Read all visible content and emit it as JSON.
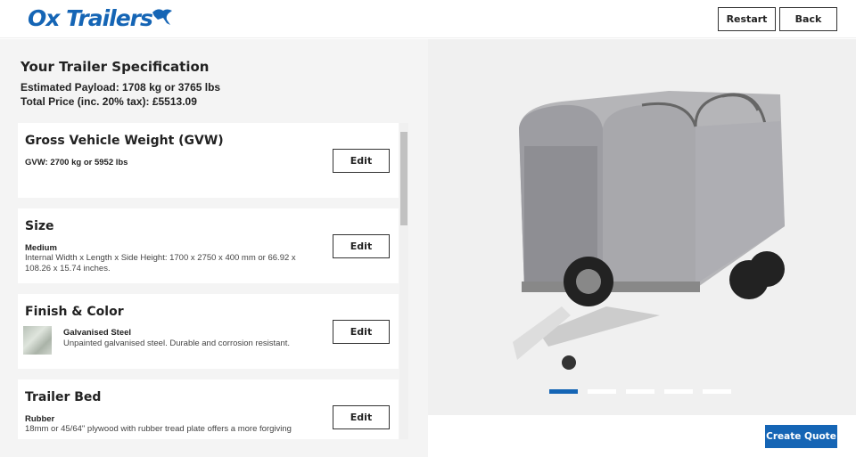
{
  "header": {
    "logo": "Ox Trailers",
    "restart": "Restart",
    "back": "Back"
  },
  "spec": {
    "title": "Your Trailer Specification",
    "payload": "Estimated Payload: 1708 kg or 3765 lbs",
    "price": "Total Price (inc. 20% tax): £5513.09"
  },
  "cards": [
    {
      "title": "Gross Vehicle Weight (GVW)",
      "bold": "GVW: 2700 kg or 5952 lbs",
      "desc": "",
      "edit": "Edit"
    },
    {
      "title": "Size",
      "bold": "Medium",
      "desc": "Internal Width x Length x Side Height: 1700 x 2750 x 400 mm or 66.92 x 108.26 x 15.74 inches.",
      "edit": "Edit"
    },
    {
      "title": "Finish & Color",
      "bold": "Galvanised Steel",
      "desc": "Unpainted galvanised steel. Durable and corrosion resistant.",
      "edit": "Edit"
    },
    {
      "title": "Trailer Bed",
      "bold": "Rubber",
      "desc": "18mm or 45/64\" plywood with rubber tread plate offers a more forgiving",
      "edit": "Edit"
    }
  ],
  "carousel": {
    "slides": 5,
    "active": 1
  },
  "create_quote": "Create Quote",
  "colors": {
    "accent": "#1565b5"
  }
}
